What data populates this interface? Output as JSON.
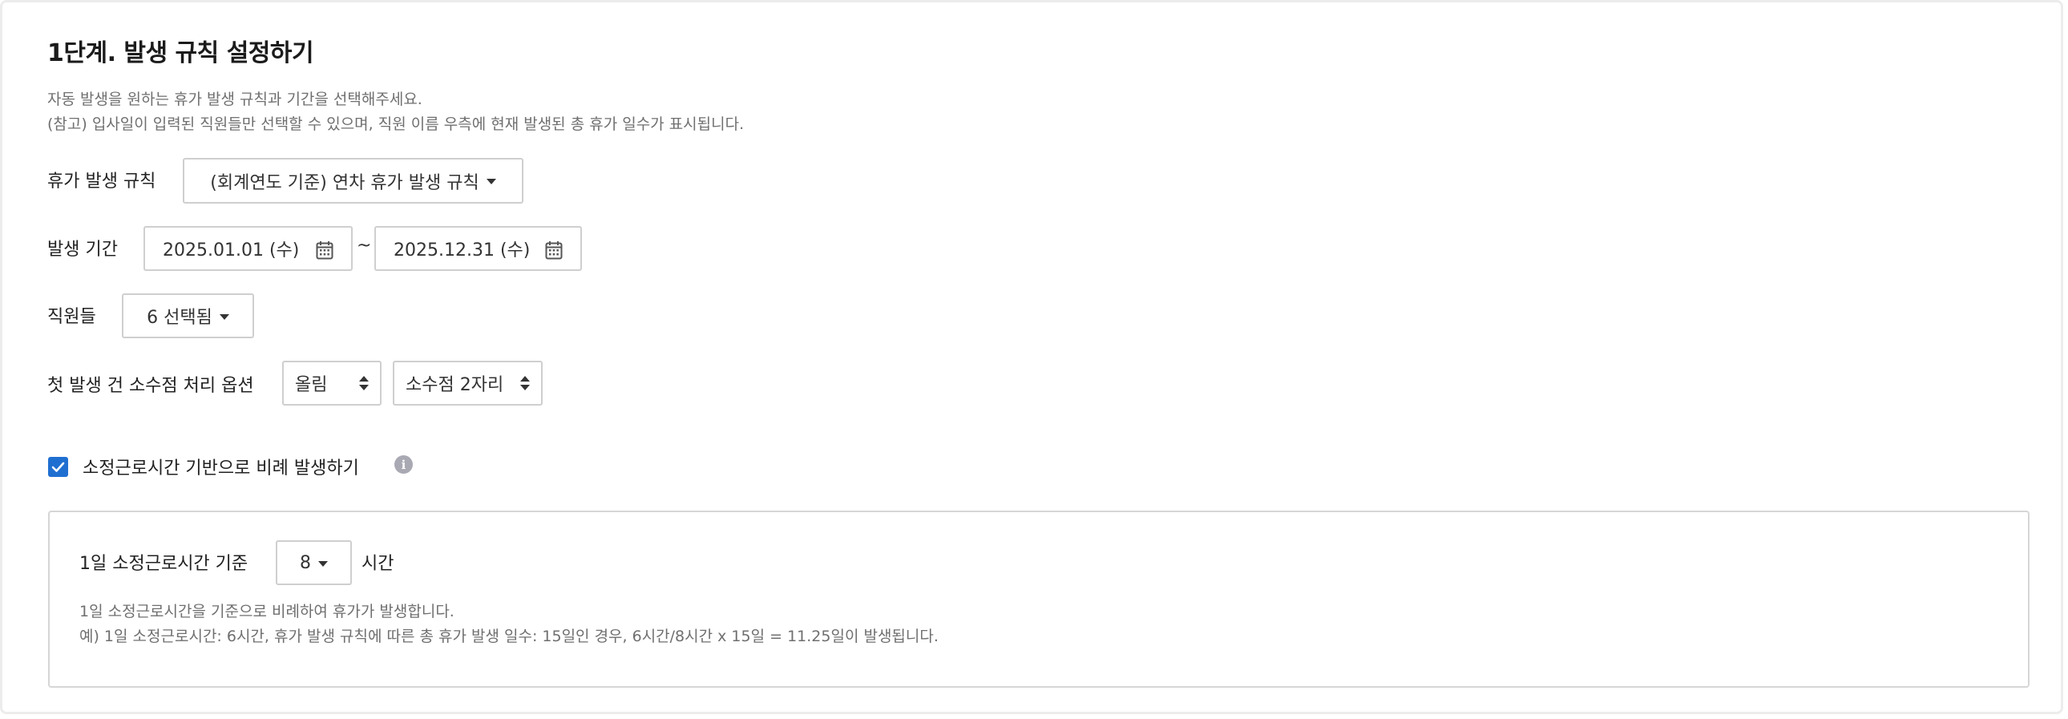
{
  "section": {
    "title": "1단계. 발생 규칙 설정하기",
    "desc_line1": "자동 발생을 원하는 휴가 발생 규칙과 기간을 선택해주세요.",
    "desc_line2": "(참고) 입사일이 입력된 직원들만 선택할 수 있으며, 직원 이름 우측에 현재 발생된 총 휴가 일수가 표시됩니다."
  },
  "rule": {
    "label": "휴가 발생 규칙",
    "value": "(회계연도 기준) 연차 휴가 발생 규칙"
  },
  "period": {
    "label": "발생 기간",
    "start": "2025.01.01 (수)",
    "separator": "~",
    "end": "2025.12.31 (수)"
  },
  "employees": {
    "label": "직원들",
    "value": "6 선택됨"
  },
  "rounding": {
    "label": "첫 발생 건 소수점 처리 옵션",
    "method": "올림",
    "precision": "소수점 2자리"
  },
  "proportional": {
    "checked": true,
    "label": "소정근로시간 기반으로 비례 발생하기",
    "info_icon": "info-icon"
  },
  "hours_panel": {
    "label": "1일 소정근로시간 기준",
    "value": "8",
    "unit": "시간",
    "desc_line1": "1일 소정근로시간을 기준으로 비례하여 휴가가 발생합니다.",
    "desc_line2": "예) 1일 소정근로시간: 6시간, 휴가 발생 규칙에 따른 총 휴가 발생 일수: 15일인 경우, 6시간/8시간 x 15일 = 11.25일이 발생됩니다."
  },
  "colors": {
    "accent": "#1f6fd1",
    "border": "#cfcfcf",
    "muted_text": "#6f6f6f"
  }
}
